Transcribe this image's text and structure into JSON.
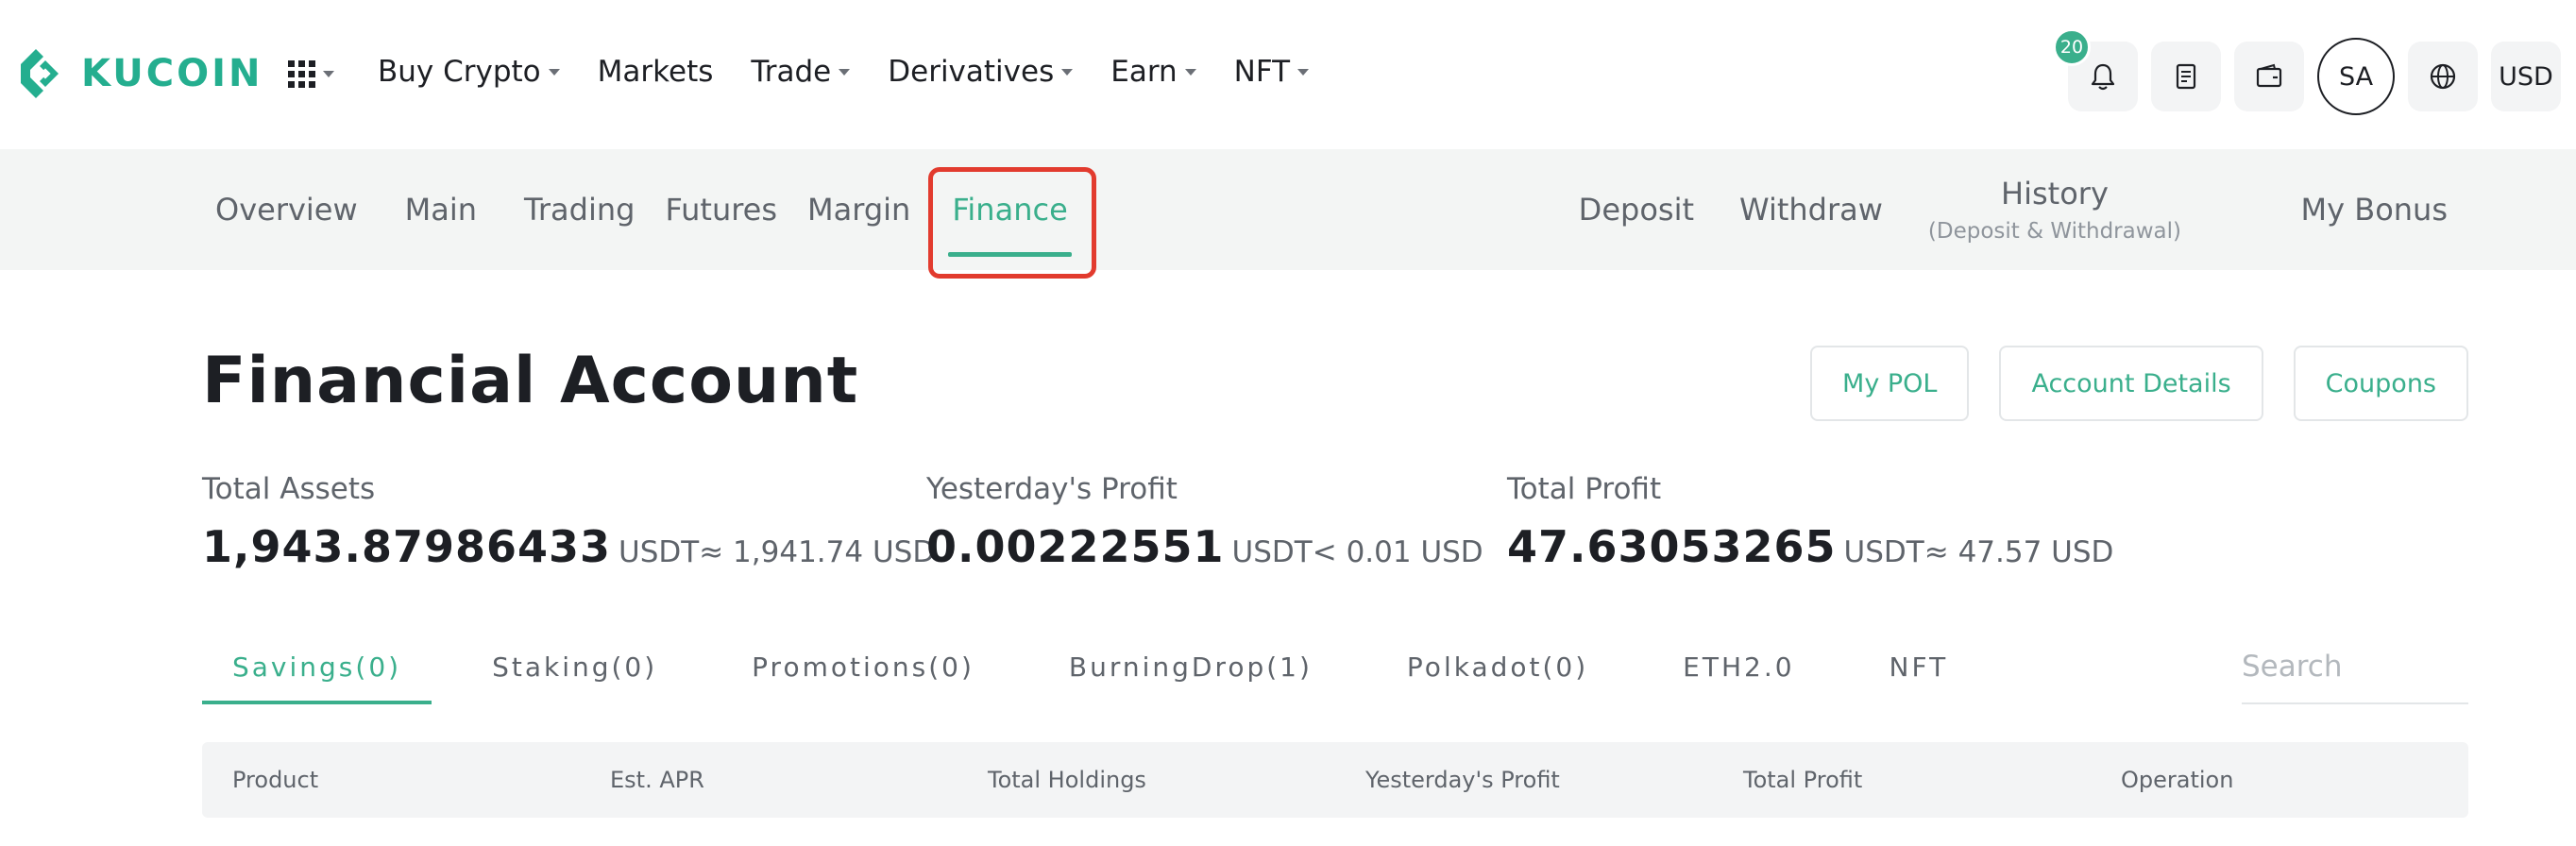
{
  "brand": {
    "name": "KUCOIN",
    "color": "#24ae8f"
  },
  "top_menu": [
    {
      "label": "Buy Crypto",
      "dropdown": true
    },
    {
      "label": "Markets",
      "dropdown": false
    },
    {
      "label": "Trade",
      "dropdown": true
    },
    {
      "label": "Derivatives",
      "dropdown": true
    },
    {
      "label": "Earn",
      "dropdown": true
    },
    {
      "label": "NFT",
      "dropdown": true
    }
  ],
  "toolbar": {
    "notification_count": "20",
    "avatar_initials": "SA",
    "currency": "USD"
  },
  "subnav": {
    "left_tabs": [
      "Overview",
      "Main",
      "Trading",
      "Futures",
      "Margin",
      "Finance"
    ],
    "active_tab": "Finance",
    "deposit": "Deposit",
    "withdraw": "Withdraw",
    "history": "History",
    "history_sub": "(Deposit & Withdrawal)",
    "bonus": "My Bonus"
  },
  "page": {
    "title": "Financial Account",
    "actions": [
      "My POL",
      "Account Details",
      "Coupons"
    ]
  },
  "stats": {
    "total_assets": {
      "label": "Total Assets",
      "value": "1,943.87986433",
      "unit": "USDT",
      "approx": "≈ 1,941.74 USD"
    },
    "yesterday_profit": {
      "label": "Yesterday's Profit",
      "value": "0.00222551",
      "unit": "USDT",
      "approx": "< 0.01 USD"
    },
    "total_profit": {
      "label": "Total Profit",
      "value": "47.63053265",
      "unit": "USDT",
      "approx": "≈ 47.57 USD"
    }
  },
  "product_tabs": [
    "Savings(0)",
    "Staking(0)",
    "Promotions(0)",
    "BurningDrop(1)",
    "Polkadot(0)",
    "ETH2.0",
    "NFT"
  ],
  "search": {
    "placeholder": "Search"
  },
  "table": {
    "columns": [
      "Product",
      "Est. APR",
      "Total Holdings",
      "Yesterday's Profit",
      "Total Profit",
      "Operation"
    ]
  },
  "colors": {
    "accent": "#3aaf8c",
    "highlight": "#e23b2e"
  }
}
